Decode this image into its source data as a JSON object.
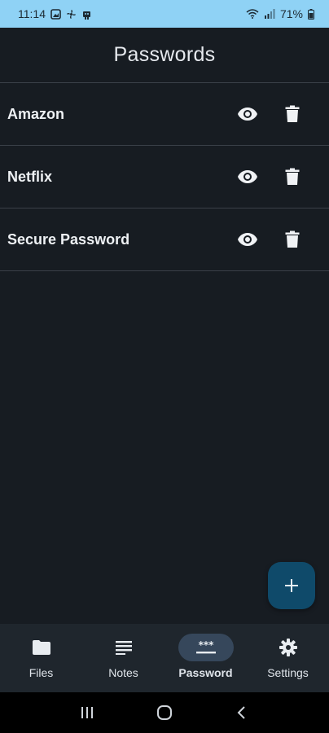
{
  "status_bar": {
    "time": "11:14",
    "battery": "71%",
    "left_icons": [
      "gallery-icon",
      "fan-icon",
      "robot-icon"
    ],
    "right_icons": [
      "wifi-icon",
      "signal-icon",
      "battery-icon"
    ]
  },
  "app_bar": {
    "title": "Passwords"
  },
  "passwords": [
    {
      "label": "Amazon"
    },
    {
      "label": "Netflix"
    },
    {
      "label": "Secure Password"
    }
  ],
  "fab": {
    "icon": "plus-icon"
  },
  "bottom_nav": {
    "items": [
      {
        "label": "Files",
        "icon": "folder-icon",
        "active": false
      },
      {
        "label": "Notes",
        "icon": "notes-icon",
        "active": false
      },
      {
        "label": "Password",
        "icon": "password-icon",
        "active": true
      },
      {
        "label": "Settings",
        "icon": "gear-icon",
        "active": false
      }
    ]
  },
  "colors": {
    "background": "#171c22",
    "status_bar": "#8fd2f5",
    "fab": "#0f4a6a",
    "nav_active_pill": "#36475b",
    "text": "#eef1f4"
  }
}
